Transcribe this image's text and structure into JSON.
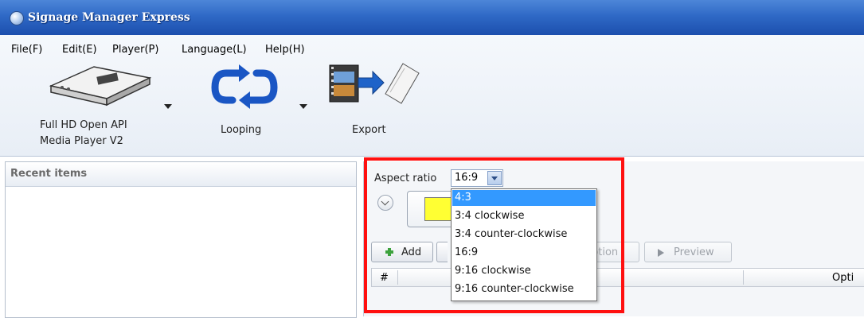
{
  "window": {
    "title": "Signage Manager Express"
  },
  "menu": [
    {
      "label": "File(F)"
    },
    {
      "label": "Edit(E)"
    },
    {
      "label": "Player(P)"
    },
    {
      "label": "Language(L)"
    },
    {
      "label": "Help(H)"
    }
  ],
  "toolbar": {
    "player": {
      "line1": "Full HD Open API",
      "line2": "Media Player V2"
    },
    "looping": "Looping",
    "export": "Export"
  },
  "recent": {
    "header": "Recent items"
  },
  "aspect": {
    "label": "Aspect ratio",
    "value": "16:9",
    "options": [
      "4:3",
      "3:4 clockwise",
      "3:4 counter-clockwise",
      "16:9",
      "9:16 clockwise",
      "9:16 counter-clockwise"
    ],
    "highlighted": "4:3"
  },
  "actions": {
    "add": "Add",
    "option_partial": "ption",
    "preview": "Preview"
  },
  "grid": {
    "col_hash": "#",
    "col_options": "Opti"
  },
  "colors": {
    "swatch": "#ffff33",
    "highlight_box": "#ff1010",
    "selection": "#3399ff"
  }
}
